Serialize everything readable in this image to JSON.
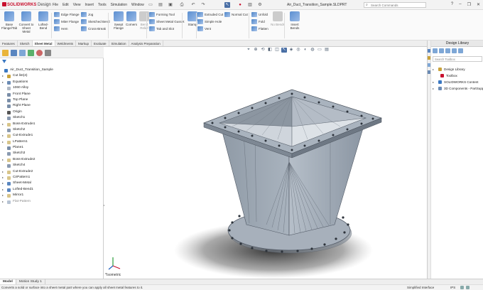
{
  "app": {
    "logo_brand": "SOLIDWORKS",
    "logo_product": "Design",
    "document_title": "Air_Duct_Transition_Sample.SLDPRT",
    "menu": [
      "File",
      "Edit",
      "View",
      "Insert",
      "Tools",
      "Simulation",
      "Window"
    ],
    "search_placeholder": "Search Commands",
    "window_controls": [
      "?",
      "–",
      "❐",
      "✕"
    ]
  },
  "ribbon": {
    "big_buttons": [
      {
        "label": "Base Flange/Tab",
        "name": "base-flange-tab-button",
        "icon": "base-flange-icon"
      },
      {
        "label": "Convert to Sheet Metal",
        "name": "convert-to-sheet-metal-button",
        "icon": "convert-sheet-metal-icon"
      },
      {
        "label": "Lofted-Bend",
        "name": "lofted-bend-button",
        "icon": "lofted-bend-icon"
      },
      {
        "label": "Swept Flange",
        "name": "swept-flange-button",
        "icon": "swept-flange-icon"
      },
      {
        "label": "Corners",
        "name": "corners-button",
        "icon": "corners-icon"
      },
      {
        "label": "Bend Relief",
        "name": "bend-relief-button",
        "icon": "bend-relief-icon",
        "disabled": true
      },
      {
        "label": "Stamp",
        "name": "stamp-button",
        "icon": "stamp-icon"
      },
      {
        "label": "No Bends",
        "name": "no-bends-button",
        "icon": "no-bends-icon",
        "disabled": true
      },
      {
        "label": "Insert Bends",
        "name": "insert-bends-button",
        "icon": "insert-bends-icon"
      }
    ],
    "small_buttons": [
      {
        "label": "Edge Flange",
        "name": "edge-flange-button",
        "icon": "edge-flange-icon"
      },
      {
        "label": "Miter Flange",
        "name": "miter-flange-button",
        "icon": "miter-flange-icon"
      },
      {
        "label": "Hem",
        "name": "hem-button",
        "icon": "hem-icon"
      },
      {
        "label": "Jog",
        "name": "jog-button",
        "icon": "jog-icon"
      },
      {
        "label": "Sketched Bend",
        "name": "sketched-bend-button",
        "icon": "sketched-bend-icon"
      },
      {
        "label": "Cross-Break",
        "name": "cross-break-button",
        "icon": "cross-break-icon"
      },
      {
        "label": "Forming Tool",
        "name": "forming-tool-button",
        "icon": "forming-tool-icon"
      },
      {
        "label": "Sheet Metal Gusset",
        "name": "sheet-metal-gusset-button",
        "icon": "gusset-icon"
      },
      {
        "label": "Tab and Slot",
        "name": "tab-and-slot-button",
        "icon": "tab-slot-icon"
      },
      {
        "label": "Extruded Cut",
        "name": "extruded-cut-button",
        "icon": "extruded-cut-icon"
      },
      {
        "label": "Simple Hole",
        "name": "simple-hole-button",
        "icon": "simple-hole-icon"
      },
      {
        "label": "Vent",
        "name": "vent-button",
        "icon": "vent-icon"
      },
      {
        "label": "Normal Cut",
        "name": "normal-cut-button",
        "icon": "normal-cut-icon"
      },
      {
        "label": "Unfold",
        "name": "unfold-button",
        "icon": "unfold-icon"
      },
      {
        "label": "Fold",
        "name": "fold-button",
        "icon": "fold-icon"
      },
      {
        "label": "Flatten",
        "name": "flatten-button",
        "icon": "flatten-icon"
      }
    ]
  },
  "tabs": [
    "Features",
    "Sketch",
    "Sheet Metal",
    "Weldments",
    "Markup",
    "Evaluate",
    "Simulation",
    "Analysis Preparation"
  ],
  "active_tab": "Sheet Metal",
  "feature_tree": [
    {
      "label": "Air_Duct_Transition_Sample",
      "indent": 0,
      "arrow": "",
      "icon_color": "#3a78c2"
    },
    {
      "label": "Cut list(4)",
      "indent": 1,
      "arrow": "▸",
      "icon_color": "#c9a23a"
    },
    {
      "label": "Equations",
      "indent": 1,
      "arrow": "▸",
      "icon_color": "#6b8bb4"
    },
    {
      "label": "1060 Alloy",
      "indent": 1,
      "arrow": "",
      "icon_color": "#b0b8c4"
    },
    {
      "label": "Front Plane",
      "indent": 1,
      "arrow": "",
      "icon_color": "#7a8ea8"
    },
    {
      "label": "Top Plane",
      "indent": 1,
      "arrow": "",
      "icon_color": "#7a8ea8"
    },
    {
      "label": "Right Plane",
      "indent": 1,
      "arrow": "",
      "icon_color": "#7a8ea8"
    },
    {
      "label": "Origin",
      "indent": 1,
      "arrow": "",
      "icon_color": "#555555"
    },
    {
      "label": "Sketch1",
      "indent": 1,
      "arrow": "",
      "icon_color": "#8a9ab0"
    },
    {
      "label": "Boss-Extrude1",
      "indent": 1,
      "arrow": "▸",
      "icon_color": "#d8c58a"
    },
    {
      "label": "Sketch2",
      "indent": 1,
      "arrow": "",
      "icon_color": "#8a9ab0"
    },
    {
      "label": "Cut-Extrude1",
      "indent": 1,
      "arrow": "▸",
      "icon_color": "#d8c58a"
    },
    {
      "label": "LPattern1",
      "indent": 1,
      "arrow": "▸",
      "icon_color": "#d8c58a"
    },
    {
      "label": "Plane1",
      "indent": 1,
      "arrow": "",
      "icon_color": "#7a8ea8"
    },
    {
      "label": "Sketch3",
      "indent": 1,
      "arrow": "",
      "icon_color": "#8a9ab0"
    },
    {
      "label": "Boss-Extrude2",
      "indent": 1,
      "arrow": "▸",
      "icon_color": "#d8c58a"
    },
    {
      "label": "Sketch4",
      "indent": 1,
      "arrow": "",
      "icon_color": "#8a9ab0"
    },
    {
      "label": "Cut-Extrude2",
      "indent": 1,
      "arrow": "▸",
      "icon_color": "#d8c58a"
    },
    {
      "label": "CirPattern1",
      "indent": 1,
      "arrow": "▸",
      "icon_color": "#d8c58a"
    },
    {
      "label": "Sheet-Metal",
      "indent": 1,
      "arrow": "▸",
      "icon_color": "#5a86c0"
    },
    {
      "label": "Lofted-Bend1",
      "indent": 1,
      "arrow": "▸",
      "icon_color": "#5a86c0"
    },
    {
      "label": "Mirror1",
      "indent": 1,
      "arrow": "▸",
      "icon_color": "#d8c58a"
    },
    {
      "label": "Flat-Pattern",
      "indent": 1,
      "arrow": "▸",
      "icon_color": "#b7c3d3",
      "grey": true
    }
  ],
  "view_label": "*Isometric",
  "design_library": {
    "title": "Design Library",
    "search_placeholder": "Search Toolbox",
    "items": [
      {
        "label": "Design Library",
        "arrow": "▸",
        "icon_color": "#c9a23a",
        "indent": 0
      },
      {
        "label": "Toolbox",
        "arrow": "",
        "icon_color": "#c8102e",
        "indent": 1
      },
      {
        "label": "SOLIDWORKS Content",
        "arrow": "▸",
        "icon_color": "#3a78c2",
        "indent": 0
      },
      {
        "label": "3D Components - PartSupply",
        "arrow": "▸",
        "icon_color": "#6b8bb4",
        "indent": 0
      }
    ]
  },
  "bottom_tabs": [
    "Model",
    "Motion Study 1"
  ],
  "status": {
    "text": "Converts a solid or surface into a sheet metal part where you can apply all sheet metal features to it.",
    "mode": "Simplified Interface",
    "units": "IPS"
  }
}
